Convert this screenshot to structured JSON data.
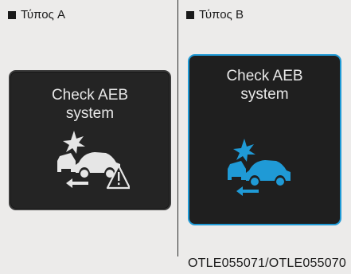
{
  "labels": {
    "type_a": "Τύπος A",
    "type_b": "Τύπος B"
  },
  "panels": [
    {
      "id": "a",
      "title": "Check AEB\nsystem",
      "icon": "collision-warning-icon-with-triangle",
      "icon_color": "#e6e6e6",
      "border_color": "#3b3b3b"
    },
    {
      "id": "b",
      "title": "Check AEB\nsystem",
      "icon": "collision-warning-icon",
      "icon_color": "#1f9ad6",
      "border_color": "#1f9ad6"
    }
  ],
  "figure_code": "OTLE055071/OTLE055070"
}
